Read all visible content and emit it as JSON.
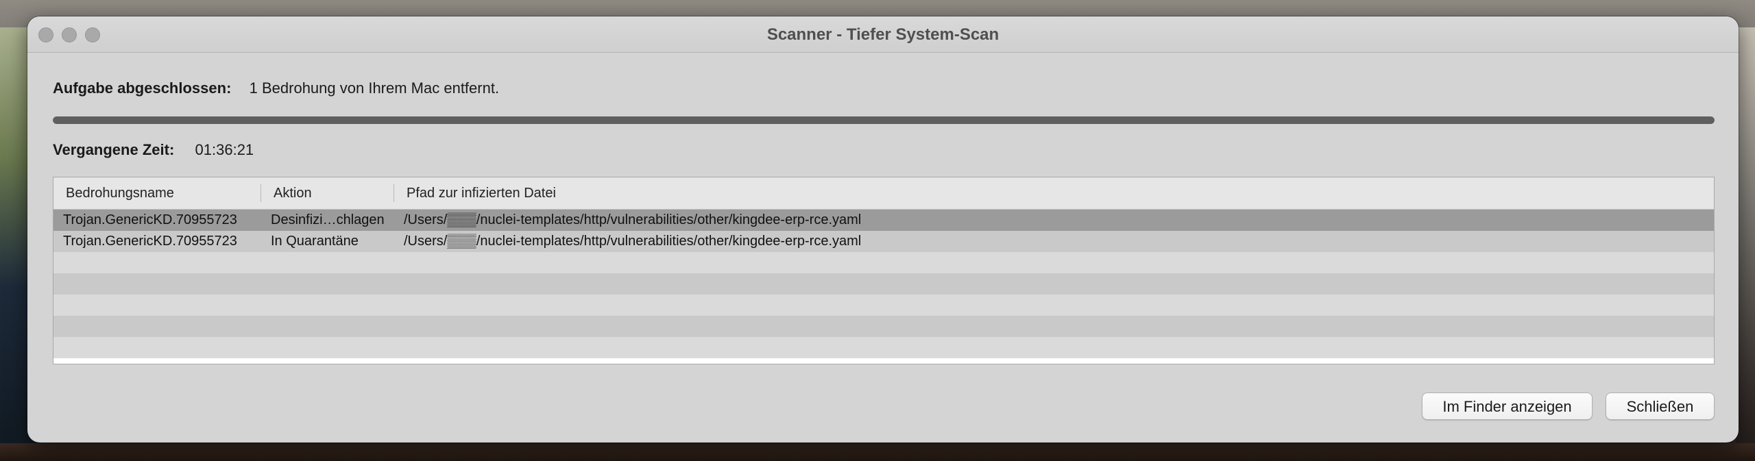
{
  "window": {
    "title": "Scanner - Tiefer System-Scan"
  },
  "status": {
    "label": "Aufgabe abgeschlossen:",
    "message": "1 Bedrohung von Ihrem Mac entfernt."
  },
  "progress": {
    "value": 1.0
  },
  "elapsed": {
    "label": "Vergangene Zeit:",
    "value": "01:36:21"
  },
  "table": {
    "columns": [
      "Bedrohungsname",
      "Aktion",
      "Pfad zur infizierten Datei"
    ],
    "rows": [
      {
        "name": "Trojan.GenericKD.70955723",
        "action": "Desinfizi…chlagen",
        "path": "/Users/▒▒▒/nuclei-templates/http/vulnerabilities/other/kingdee-erp-rce.yaml",
        "selected": true
      },
      {
        "name": "Trojan.GenericKD.70955723",
        "action": "In Quarantäne",
        "path": "/Users/▒▒▒/nuclei-templates/http/vulnerabilities/other/kingdee-erp-rce.yaml",
        "selected": false
      }
    ],
    "empty_rows": 5
  },
  "buttons": {
    "finder": "Im Finder anzeigen",
    "close": "Schließen"
  },
  "colors": {
    "selected_row": "#9b9b9b",
    "progress_fill": "#5f5f5f"
  }
}
